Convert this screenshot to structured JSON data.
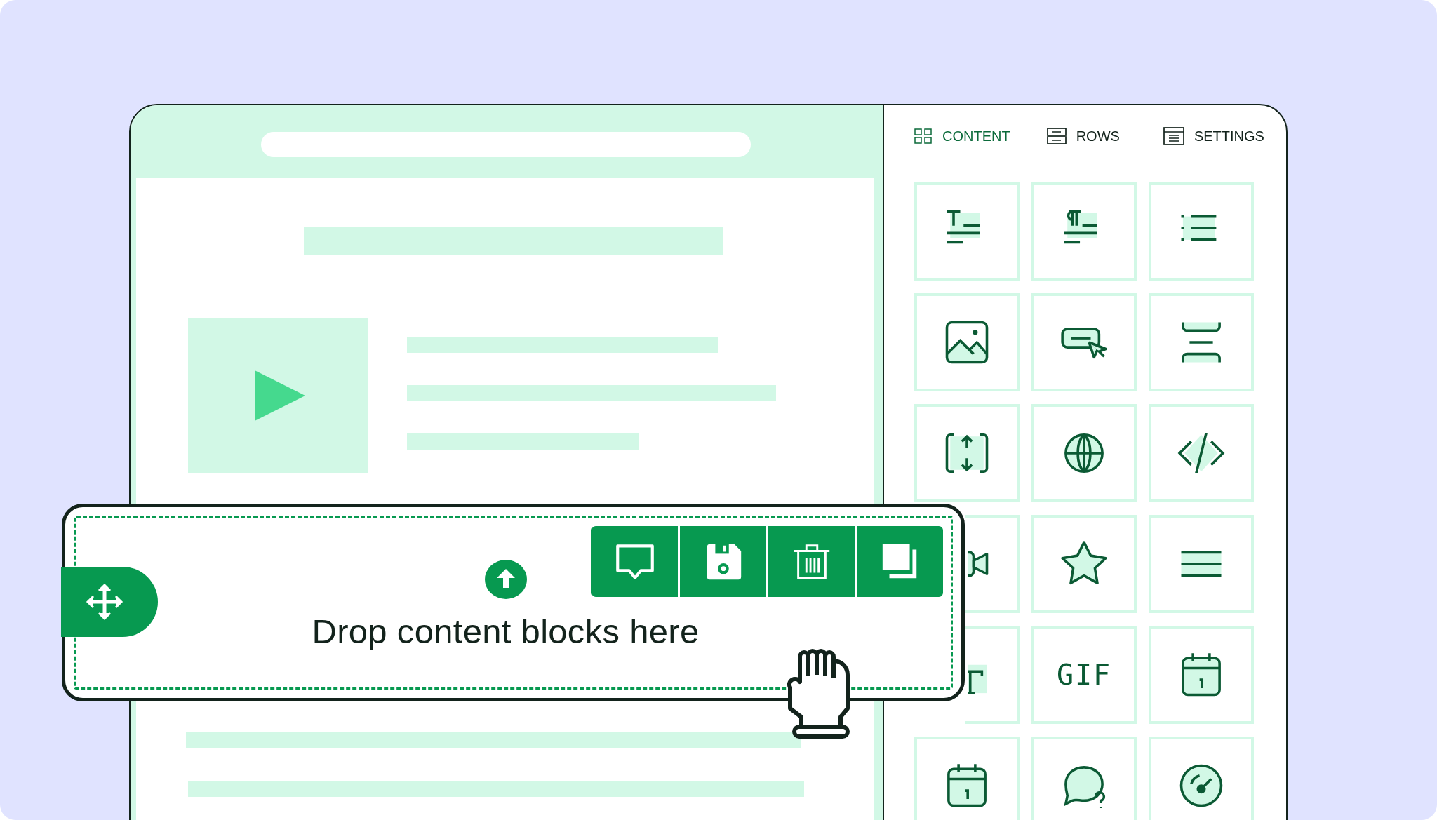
{
  "tabs": [
    {
      "label": "CONTENT",
      "kind": "grid",
      "selected": true
    },
    {
      "label": "ROWS",
      "kind": "rows",
      "selected": false
    },
    {
      "label": "SETTINGS",
      "kind": "settings",
      "selected": false
    }
  ],
  "blocks": [
    {
      "kind": "title"
    },
    {
      "kind": "paragraph"
    },
    {
      "kind": "list"
    },
    {
      "kind": "image"
    },
    {
      "kind": "button"
    },
    {
      "kind": "divider"
    },
    {
      "kind": "spacer"
    },
    {
      "kind": "social"
    },
    {
      "kind": "html"
    },
    {
      "kind": "video"
    },
    {
      "kind": "star"
    },
    {
      "kind": "menu"
    },
    {
      "kind": "text"
    },
    {
      "kind": "gif",
      "label": "GIF"
    },
    {
      "kind": "calendar"
    },
    {
      "kind": "calendar"
    },
    {
      "kind": "chat"
    },
    {
      "kind": "gauge"
    }
  ],
  "drop_zone": {
    "label": "Drop content blocks here"
  }
}
